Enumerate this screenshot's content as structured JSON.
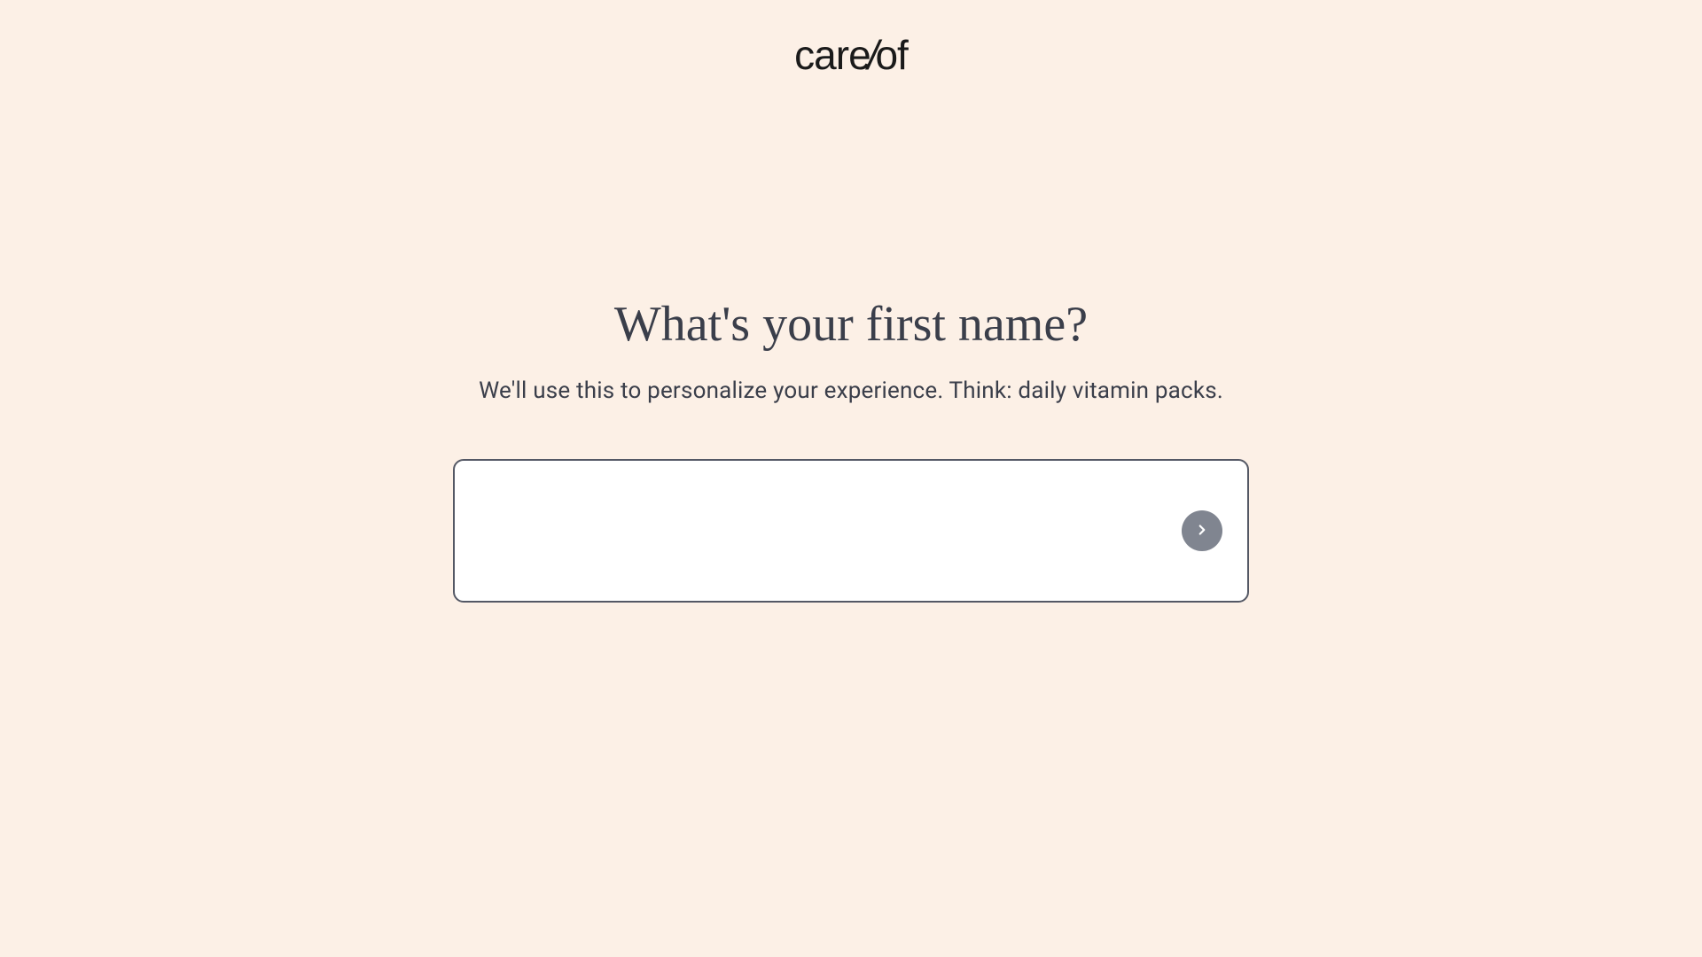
{
  "header": {
    "logo_text_1": "care",
    "logo_slash": "/",
    "logo_text_2": "of"
  },
  "question": {
    "title": "What's your first name?",
    "subtitle": "We'll use this to personalize your experience. Think: daily vitamin packs."
  },
  "form": {
    "name_value": "",
    "name_placeholder": ""
  }
}
